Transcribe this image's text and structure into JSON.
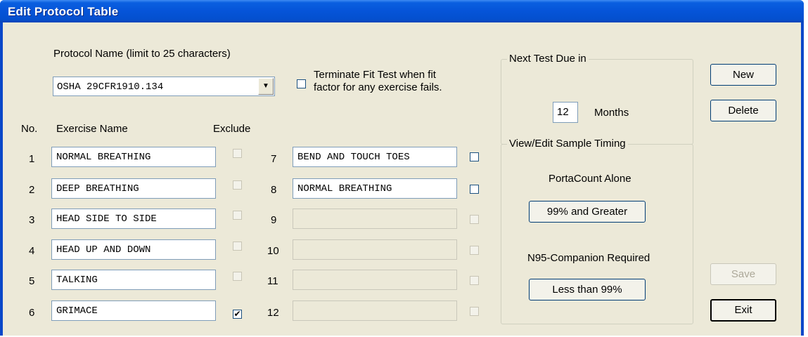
{
  "window": {
    "title": "Edit Protocol Table"
  },
  "protocol": {
    "name_label": "Protocol Name (limit to 25 characters)",
    "name_value": "OSHA 29CFR1910.134",
    "terminate_line1": "Terminate Fit Test when fit",
    "terminate_line2": "factor for any exercise fails.",
    "terminate_checked": false
  },
  "table": {
    "col_no": "No.",
    "col_name": "Exercise Name",
    "col_exclude": "Exclude",
    "left": [
      {
        "no": "1",
        "name": "NORMAL BREATHING",
        "exclude": ""
      },
      {
        "no": "2",
        "name": "DEEP BREATHING",
        "exclude": ""
      },
      {
        "no": "3",
        "name": "HEAD SIDE TO SIDE",
        "exclude": ""
      },
      {
        "no": "4",
        "name": "HEAD UP AND DOWN",
        "exclude": ""
      },
      {
        "no": "5",
        "name": "TALKING",
        "exclude": ""
      },
      {
        "no": "6",
        "name": "GRIMACE",
        "exclude": "✔"
      }
    ],
    "right": [
      {
        "no": "7",
        "name": "BEND AND TOUCH TOES",
        "exclude": ""
      },
      {
        "no": "8",
        "name": "NORMAL BREATHING",
        "exclude": ""
      },
      {
        "no": "9",
        "name": "",
        "exclude": ""
      },
      {
        "no": "10",
        "name": "",
        "exclude": ""
      },
      {
        "no": "11",
        "name": "",
        "exclude": ""
      },
      {
        "no": "12",
        "name": "",
        "exclude": ""
      }
    ]
  },
  "next_test": {
    "caption": "Next Test Due in",
    "value": "12",
    "unit": "Months"
  },
  "timing": {
    "caption": "View/Edit Sample Timing",
    "alone_label": "PortaCount Alone",
    "alone_button": "99% and Greater",
    "n95_label": "N95-Companion Required",
    "n95_button": "Less than 99%"
  },
  "buttons": {
    "new": "New",
    "delete": "Delete",
    "save": "Save",
    "exit": "Exit"
  }
}
